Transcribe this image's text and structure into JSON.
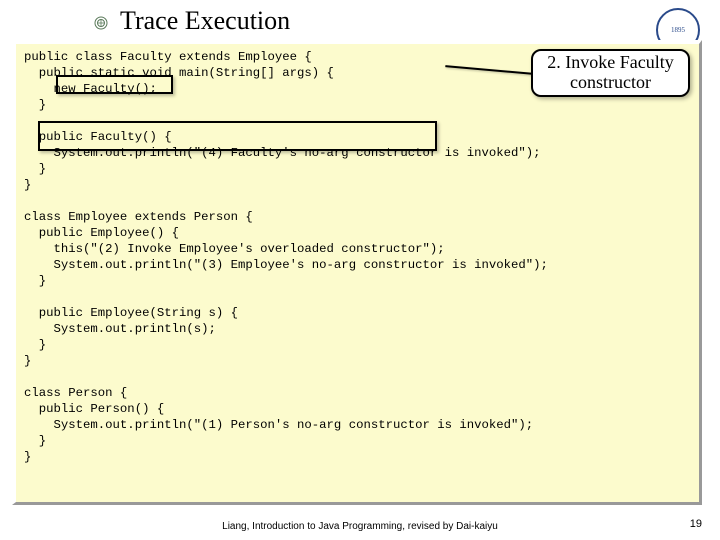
{
  "title": "Trace Execution",
  "callout_text": "2. Invoke Faculty constructor",
  "code": "public class Faculty extends Employee {\n  public static void main(String[] args) {\n    new Faculty();\n  }\n\n  public Faculty() {\n    System.out.println(\"(4) Faculty's no-arg constructor is invoked\");\n  }\n}\n\nclass Employee extends Person {\n  public Employee() {\n    this(\"(2) Invoke Employee's overloaded constructor\");\n    System.out.println(\"(3) Employee's no-arg constructor is invoked\");\n  }\n\n  public Employee(String s) {\n    System.out.println(s);\n  }\n}\n\nclass Person {\n  public Person() {\n    System.out.println(\"(1) Person's no-arg constructor is invoked\");\n  }\n}",
  "footer": "Liang, Introduction to Java Programming, revised by Dai-kaiyu",
  "page_number": "19",
  "logo_text": "1895"
}
